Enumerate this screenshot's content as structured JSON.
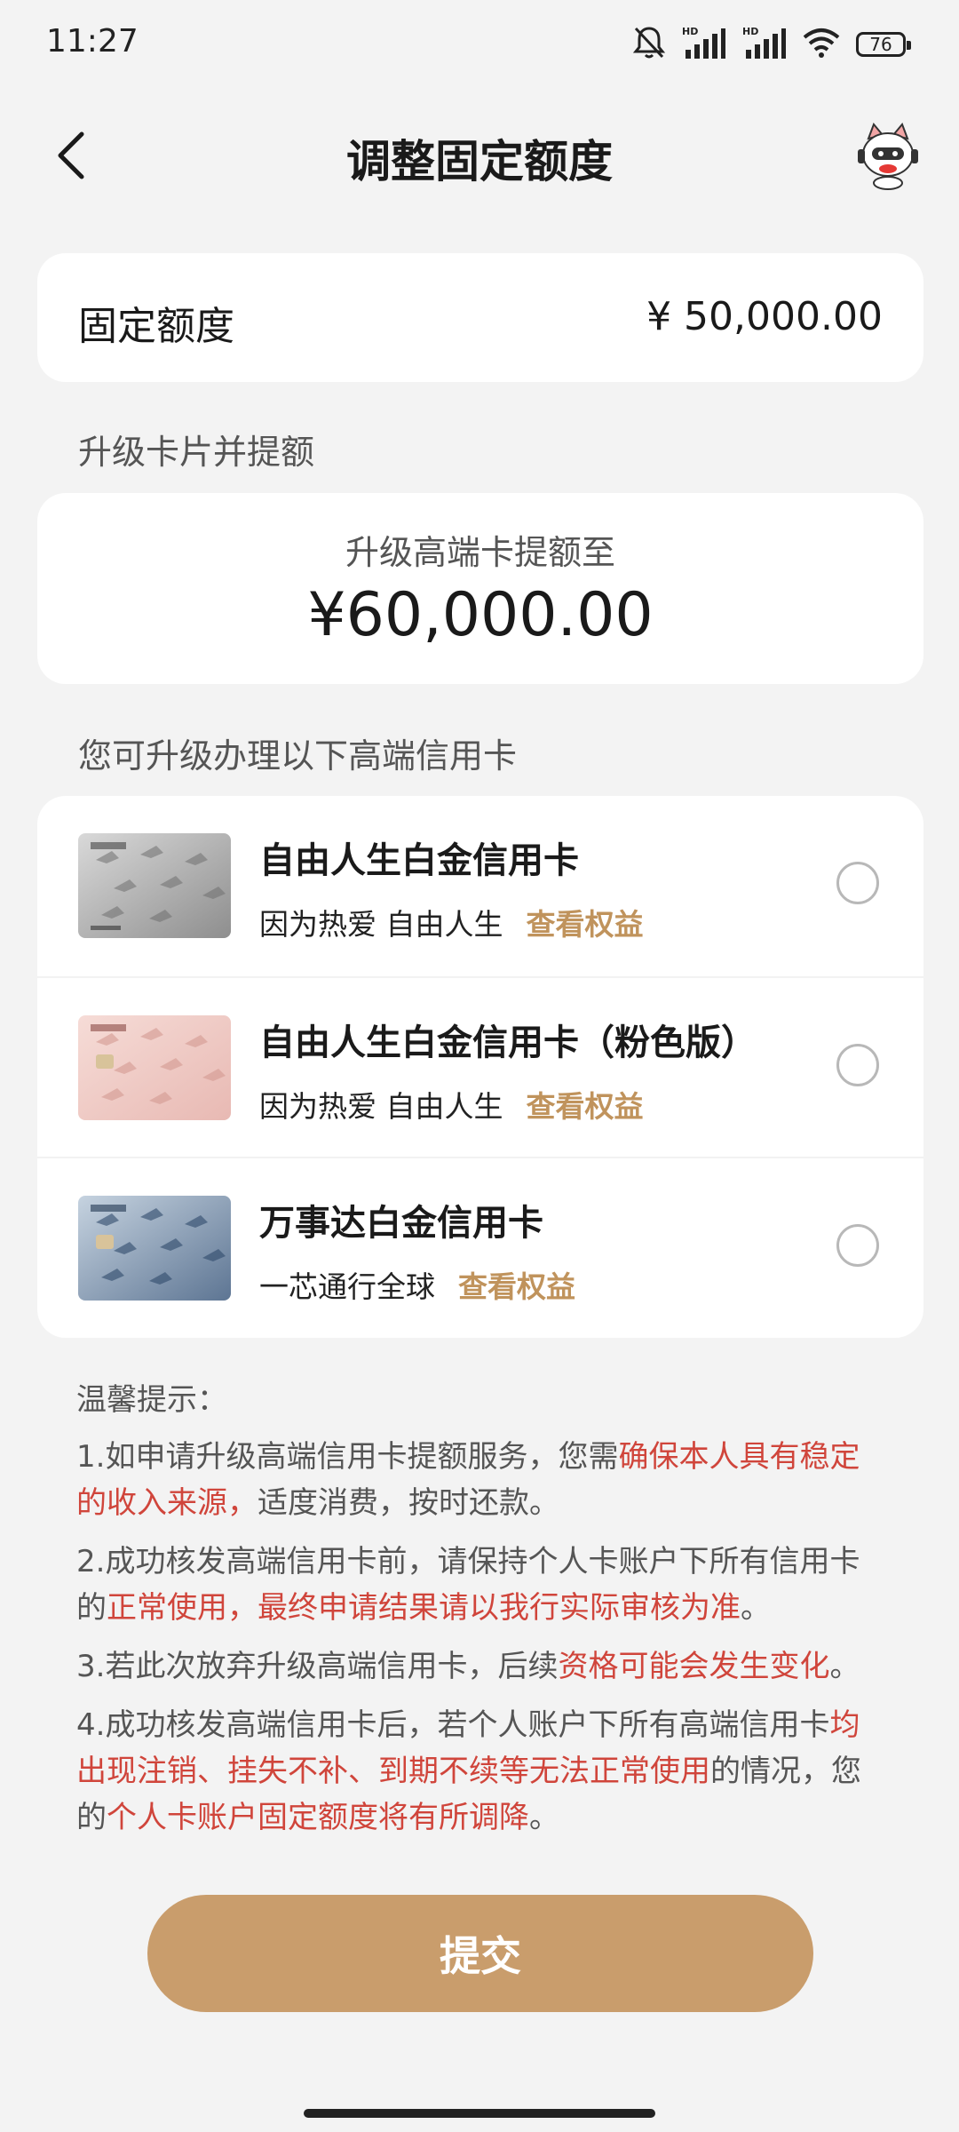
{
  "status_bar": {
    "time": "11:27",
    "battery": "76",
    "icons": [
      "bell-muted-icon",
      "hd-signal-icon",
      "hd-signal-icon",
      "wifi-icon",
      "battery-icon"
    ]
  },
  "nav": {
    "title": "调整固定额度",
    "back_icon": "chevron-left-icon",
    "assistant_icon": "robot-cat-avatar-icon"
  },
  "fixed_limit": {
    "label": "固定额度",
    "value": "¥ 50,000.00"
  },
  "upgrade": {
    "section_title": "升级卡片并提额",
    "subtitle": "升级高端卡提额至",
    "amount": "¥60,000.00"
  },
  "cards_section_title": "您可升级办理以下高端信用卡",
  "cards": [
    {
      "name": "自由人生白金信用卡",
      "slogan": "因为热爱 自由人生",
      "link": "查看权益",
      "selected": false,
      "theme": "silver"
    },
    {
      "name": "自由人生白金信用卡（粉色版）",
      "slogan": "因为热爱 自由人生",
      "link": "查看权益",
      "selected": false,
      "theme": "pink"
    },
    {
      "name": "万事达白金信用卡",
      "slogan": "一芯通行全球",
      "link": "查看权益",
      "selected": false,
      "theme": "blue"
    }
  ],
  "tips": {
    "title": "温馨提示：",
    "items": [
      {
        "a": "1.如申请升级高端信用卡提额服务，您需",
        "b": "确保本人具有稳定的收入来源，",
        "c": "适度消费，按时还款。",
        "d": "",
        "e": ""
      },
      {
        "a": "2.成功核发高端信用卡前，请保持个人卡账户下所有信用卡的",
        "b": "正常使用，最终申请结果请以我行实际审核为准",
        "c": "。",
        "d": "",
        "e": ""
      },
      {
        "a": "3.若此次放弃升级高端信用卡，后续",
        "b": "资格可能会发生变化",
        "c": "。",
        "d": "",
        "e": ""
      },
      {
        "a": "4.成功核发高端信用卡后，若个人账户下所有高端信用卡",
        "b": "均出现注销、挂失不补、到期不续等无法正常使用",
        "c": "的情况，您的",
        "d": "个人卡账户固定额度将有所调降",
        "e": "。"
      }
    ]
  },
  "submit_label": "提交",
  "colors": {
    "accent": "#c99d6c",
    "link": "#c0935c",
    "highlight": "#d0453b",
    "background": "#f3f3f3"
  }
}
